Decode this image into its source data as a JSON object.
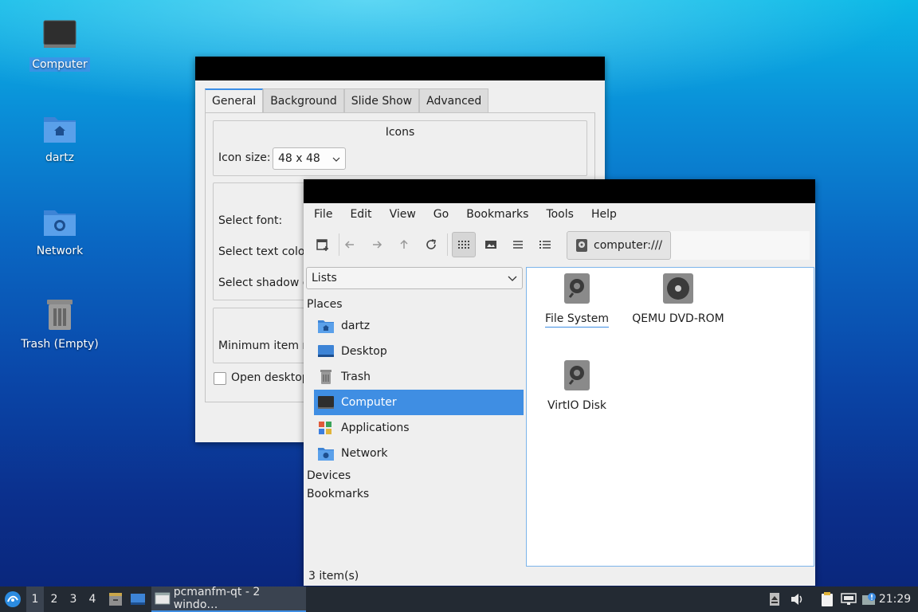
{
  "desktop": {
    "icons": [
      {
        "label": "Computer"
      },
      {
        "label": "dartz"
      },
      {
        "label": "Network"
      },
      {
        "label": "Trash (Empty)"
      }
    ]
  },
  "settings_dialog": {
    "tabs": [
      "General",
      "Background",
      "Slide Show",
      "Advanced"
    ],
    "icons_group": {
      "title": "Icons",
      "icon_size_label": "Icon size:",
      "icon_size_value": "48 x 48"
    },
    "labels": {
      "select_font": "Select font:",
      "select_text_color": "Select text colo",
      "select_shadow": "Select shadow c",
      "min_item": "Minimum item m",
      "open_desktop": "Open desktop"
    }
  },
  "file_manager": {
    "menu": [
      "File",
      "Edit",
      "View",
      "Go",
      "Bookmarks",
      "Tools",
      "Help"
    ],
    "path": "computer:///",
    "side_mode": "Lists",
    "places_header": "Places",
    "places": [
      {
        "label": "dartz"
      },
      {
        "label": "Desktop"
      },
      {
        "label": "Trash"
      },
      {
        "label": "Computer"
      },
      {
        "label": "Applications"
      },
      {
        "label": "Network"
      }
    ],
    "devices_header": "Devices",
    "bookmarks_header": "Bookmarks",
    "files": [
      {
        "label": "File System"
      },
      {
        "label": "QEMU DVD-ROM"
      },
      {
        "label": "VirtIO Disk"
      }
    ],
    "status": "3 item(s)"
  },
  "taskbar": {
    "desktops": [
      "1",
      "2",
      "3",
      "4"
    ],
    "task_label": "pcmanfm-qt - 2 windo…",
    "clock": "21:29"
  },
  "colors": {
    "accent": "#3f8ee3",
    "taskbar": "#232a33",
    "titlebar": "#000000"
  }
}
